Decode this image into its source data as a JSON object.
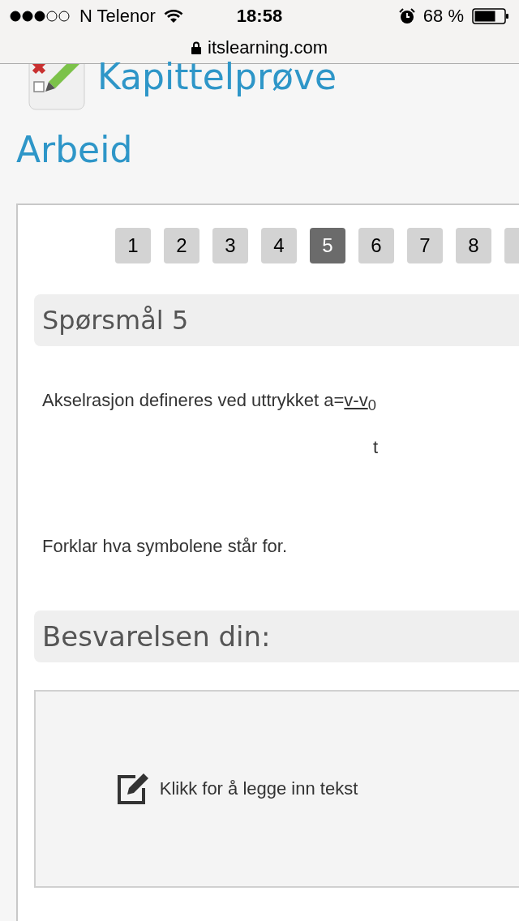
{
  "status_bar": {
    "carrier": "N Telenor",
    "time": "18:58",
    "battery": "68 %"
  },
  "address_bar": {
    "url": "itslearning.com"
  },
  "header": {
    "title": "Kapittelprøve",
    "subtitle": "Arbeid"
  },
  "pages": [
    {
      "label": "1",
      "selected": false
    },
    {
      "label": "2",
      "selected": false
    },
    {
      "label": "3",
      "selected": false
    },
    {
      "label": "4",
      "selected": false
    },
    {
      "label": "5",
      "selected": true
    },
    {
      "label": "6",
      "selected": false
    },
    {
      "label": "7",
      "selected": false
    },
    {
      "label": "8",
      "selected": false
    },
    {
      "selected": false
    }
  ],
  "question": {
    "heading": "Spørsmål 5",
    "text": "Akselrasjon defineres ved uttrykket a=",
    "numerator": "v-v$_{0}$",
    "denominator": "t",
    "instruction": "Forklar hva symbolene står for."
  },
  "answer": {
    "heading": "Besvarelsen din:",
    "prompt": "Klikk for å legge inn tekst"
  }
}
